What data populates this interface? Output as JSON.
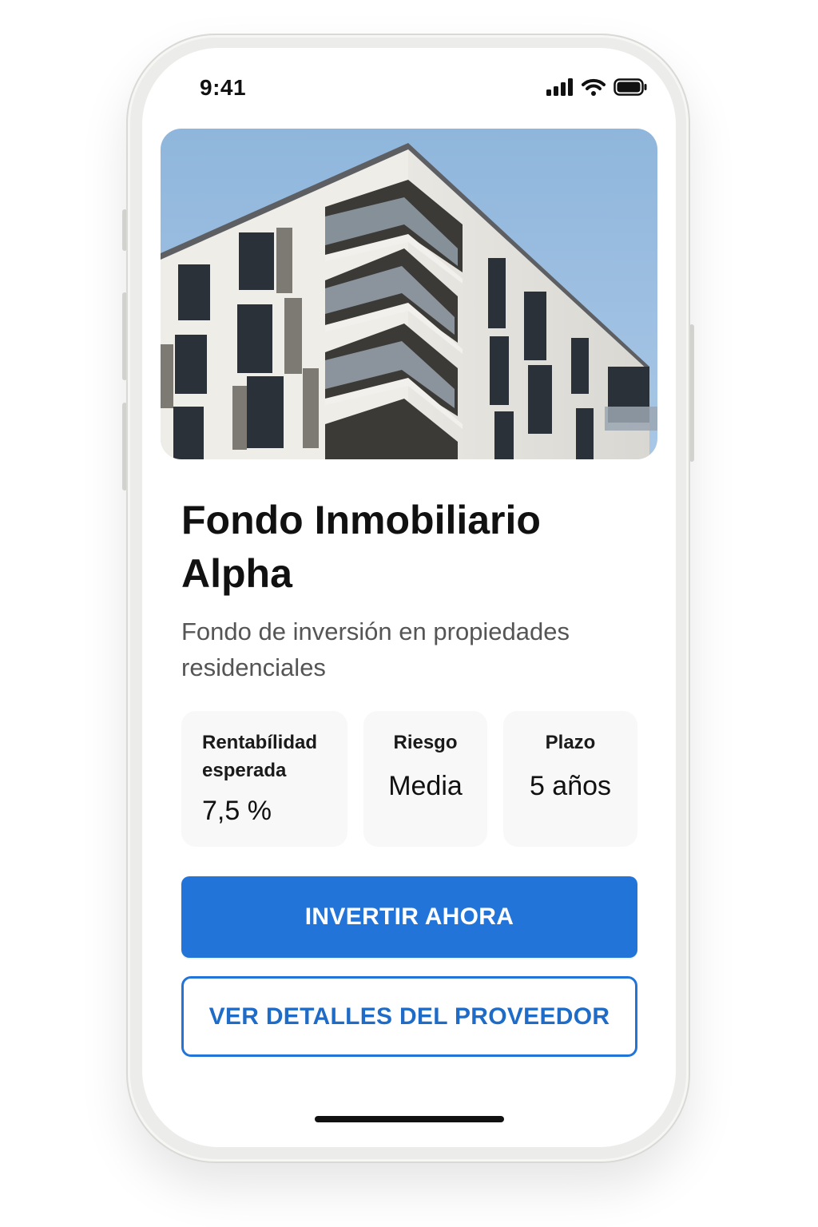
{
  "status_bar": {
    "time": "9:41",
    "icons": [
      "cellular-signal-icon",
      "wifi-icon",
      "battery-icon"
    ]
  },
  "hero": {
    "image": "apartment-building-photo"
  },
  "fund": {
    "title": "Fondo Inmobiliario Alpha",
    "description": "Fondo de inversión en propiedades residenciales"
  },
  "metrics": [
    {
      "label": "Rentabílidad esperada",
      "value": "7,5 %"
    },
    {
      "label": "Riesgo",
      "value": "Media"
    },
    {
      "label": "Plazo",
      "value": "5 años"
    }
  ],
  "actions": {
    "invest_label": "INVERTIR AHORA",
    "provider_label": "VER DETALLES DEL PROVEEDOR"
  },
  "colors": {
    "accent": "#2374d8",
    "sky": "#9dbfe0",
    "text": "#111111",
    "muted": "#555555"
  }
}
